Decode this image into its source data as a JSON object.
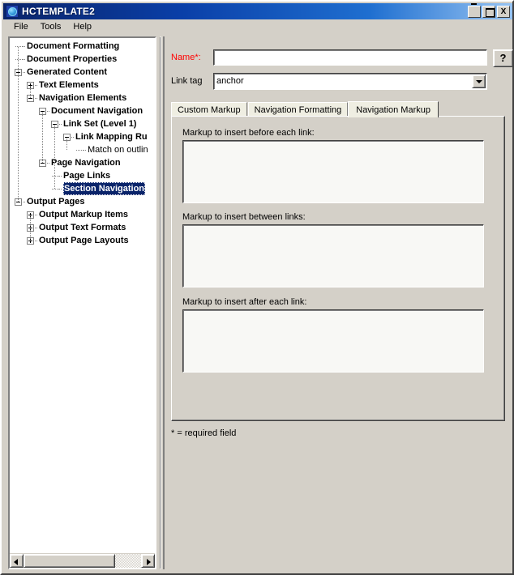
{
  "window": {
    "title": "HCTEMPLATE2",
    "icon": "globe-icon",
    "minimize_label": "_",
    "maximize_label": "",
    "close_label": "X"
  },
  "menubar": {
    "items": [
      {
        "label": "File"
      },
      {
        "label": "Tools"
      },
      {
        "label": "Help"
      }
    ]
  },
  "tree": {
    "nodes": [
      {
        "label": "Document Formatting",
        "depth": 0,
        "expander": "none",
        "bold": true,
        "selected": false
      },
      {
        "label": "Document Properties",
        "depth": 0,
        "expander": "none",
        "bold": true,
        "selected": false
      },
      {
        "label": "Generated Content",
        "depth": 0,
        "expander": "expanded",
        "bold": true,
        "selected": false
      },
      {
        "label": "Text Elements",
        "depth": 1,
        "expander": "collapsed",
        "bold": true,
        "selected": false
      },
      {
        "label": "Navigation Elements",
        "depth": 1,
        "expander": "expanded",
        "bold": true,
        "selected": false
      },
      {
        "label": "Document Navigation",
        "depth": 2,
        "expander": "expanded",
        "bold": true,
        "selected": false
      },
      {
        "label": "Link Set (Level 1)",
        "depth": 3,
        "expander": "expanded",
        "bold": true,
        "selected": false
      },
      {
        "label": "Link Mapping Ru",
        "depth": 4,
        "expander": "expanded",
        "bold": true,
        "selected": false
      },
      {
        "label": "Match on outlin",
        "depth": 5,
        "expander": "none",
        "bold": false,
        "selected": false
      },
      {
        "label": "Page Navigation",
        "depth": 2,
        "expander": "expanded",
        "bold": true,
        "selected": false
      },
      {
        "label": "Page Links",
        "depth": 3,
        "expander": "none",
        "bold": true,
        "selected": false
      },
      {
        "label": "Section Navigation",
        "depth": 3,
        "expander": "none",
        "bold": true,
        "selected": true
      },
      {
        "label": "Output Pages",
        "depth": 0,
        "expander": "expanded",
        "bold": true,
        "selected": false
      },
      {
        "label": "Output Markup Items",
        "depth": 1,
        "expander": "collapsed",
        "bold": true,
        "selected": false
      },
      {
        "label": "Output Text Formats",
        "depth": 1,
        "expander": "collapsed",
        "bold": true,
        "selected": false
      },
      {
        "label": "Output Page Layouts",
        "depth": 1,
        "expander": "collapsed",
        "bold": true,
        "selected": false
      }
    ],
    "hscroll": {
      "left_arrow": "left-arrow-icon",
      "right_arrow": "right-arrow-icon"
    }
  },
  "form": {
    "name_label": "Name*:",
    "name_value": "",
    "name_placeholder": "",
    "name_required_color": "#ff0000",
    "help_label": "?",
    "linktag_label": "Link tag",
    "linktag_value": "anchor",
    "linktag_options": [
      "anchor"
    ]
  },
  "tabs": [
    {
      "label": "Custom Markup",
      "active": false
    },
    {
      "label": "Navigation Formatting",
      "active": false
    },
    {
      "label": "Navigation Markup",
      "active": true
    }
  ],
  "markup_tab": {
    "before_label": "Markup to insert before each link:",
    "before_value": "",
    "between_label": "Markup to insert between links:",
    "between_value": "",
    "after_label": "Markup to insert after each link:",
    "after_value": ""
  },
  "footer": {
    "required_note": "* = required field"
  },
  "colors": {
    "titlebar_start": "#0a246a",
    "titlebar_end": "#96c3f2",
    "face": "#d4d0c8",
    "selection": "#0a246a",
    "required": "#ff0000",
    "tab_face": "#efeee2"
  }
}
